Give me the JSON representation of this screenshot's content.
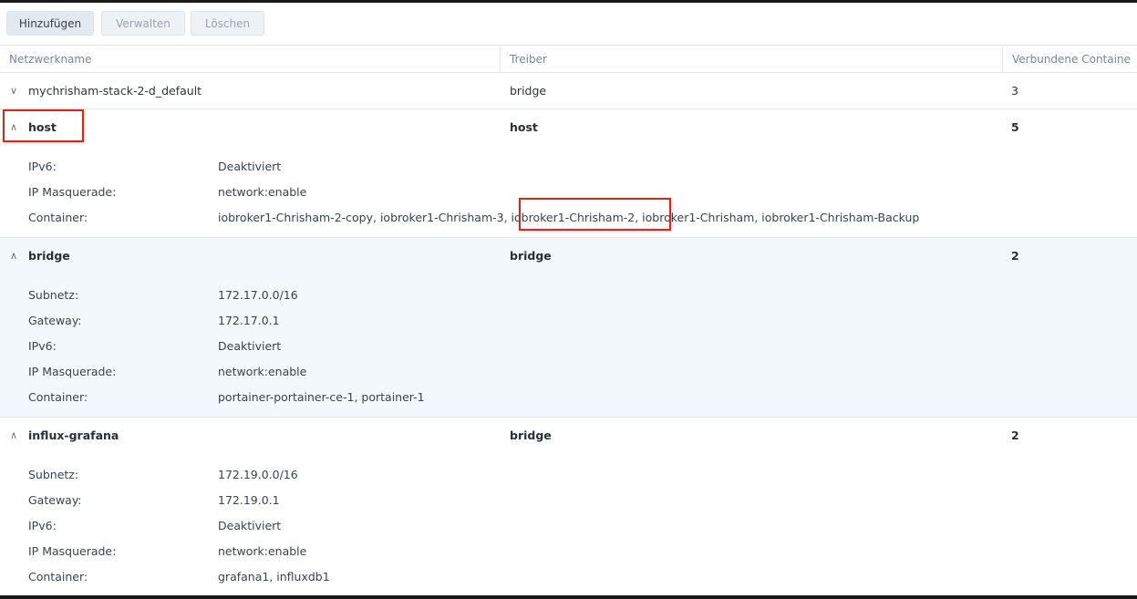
{
  "toolbar": {
    "add_label": "Hinzufügen",
    "manage_label": "Verwalten",
    "delete_label": "Löschen"
  },
  "table": {
    "columns": [
      "Netzwerkname",
      "Treiber",
      "Verbundene Containe"
    ],
    "rows": [
      {
        "name": "mychrisham-stack-2-d_default",
        "driver": "bridge",
        "count": "3",
        "expanded": false
      },
      {
        "name": "host",
        "driver": "host",
        "count": "5",
        "expanded": true,
        "details": [
          {
            "label": "IPv6:",
            "value": "Deaktiviert"
          },
          {
            "label": "IP Masquerade:",
            "value": "network:enable"
          },
          {
            "label": "Container:",
            "value": "iobroker1-Chrisham-2-copy, iobroker1-Chrisham-3, iobroker1-Chrisham-2, iobroker1-Chrisham, iobroker1-Chrisham-Backup"
          }
        ]
      },
      {
        "name": "bridge",
        "driver": "bridge",
        "count": "2",
        "expanded": true,
        "details": [
          {
            "label": "Subnetz:",
            "value": "172.17.0.0/16"
          },
          {
            "label": "Gateway:",
            "value": "172.17.0.1"
          },
          {
            "label": "IPv6:",
            "value": "Deaktiviert"
          },
          {
            "label": "IP Masquerade:",
            "value": "network:enable"
          },
          {
            "label": "Container:",
            "value": "portainer-portainer-ce-1, portainer-1"
          }
        ]
      },
      {
        "name": "influx-grafana",
        "driver": "bridge",
        "count": "2",
        "expanded": true,
        "details": [
          {
            "label": "Subnetz:",
            "value": "172.19.0.0/16"
          },
          {
            "label": "Gateway:",
            "value": "172.19.0.1"
          },
          {
            "label": "IPv6:",
            "value": "Deaktiviert"
          },
          {
            "label": "IP Masquerade:",
            "value": "network:enable"
          },
          {
            "label": "Container:",
            "value": "grafana1, influxdb1"
          }
        ]
      }
    ]
  },
  "icons": {
    "collapsed": "chevron-down-icon",
    "expanded": "chevron-up-icon"
  },
  "colors": {
    "highlight": "#d7261e",
    "selected_row": "#f3f8fc"
  }
}
